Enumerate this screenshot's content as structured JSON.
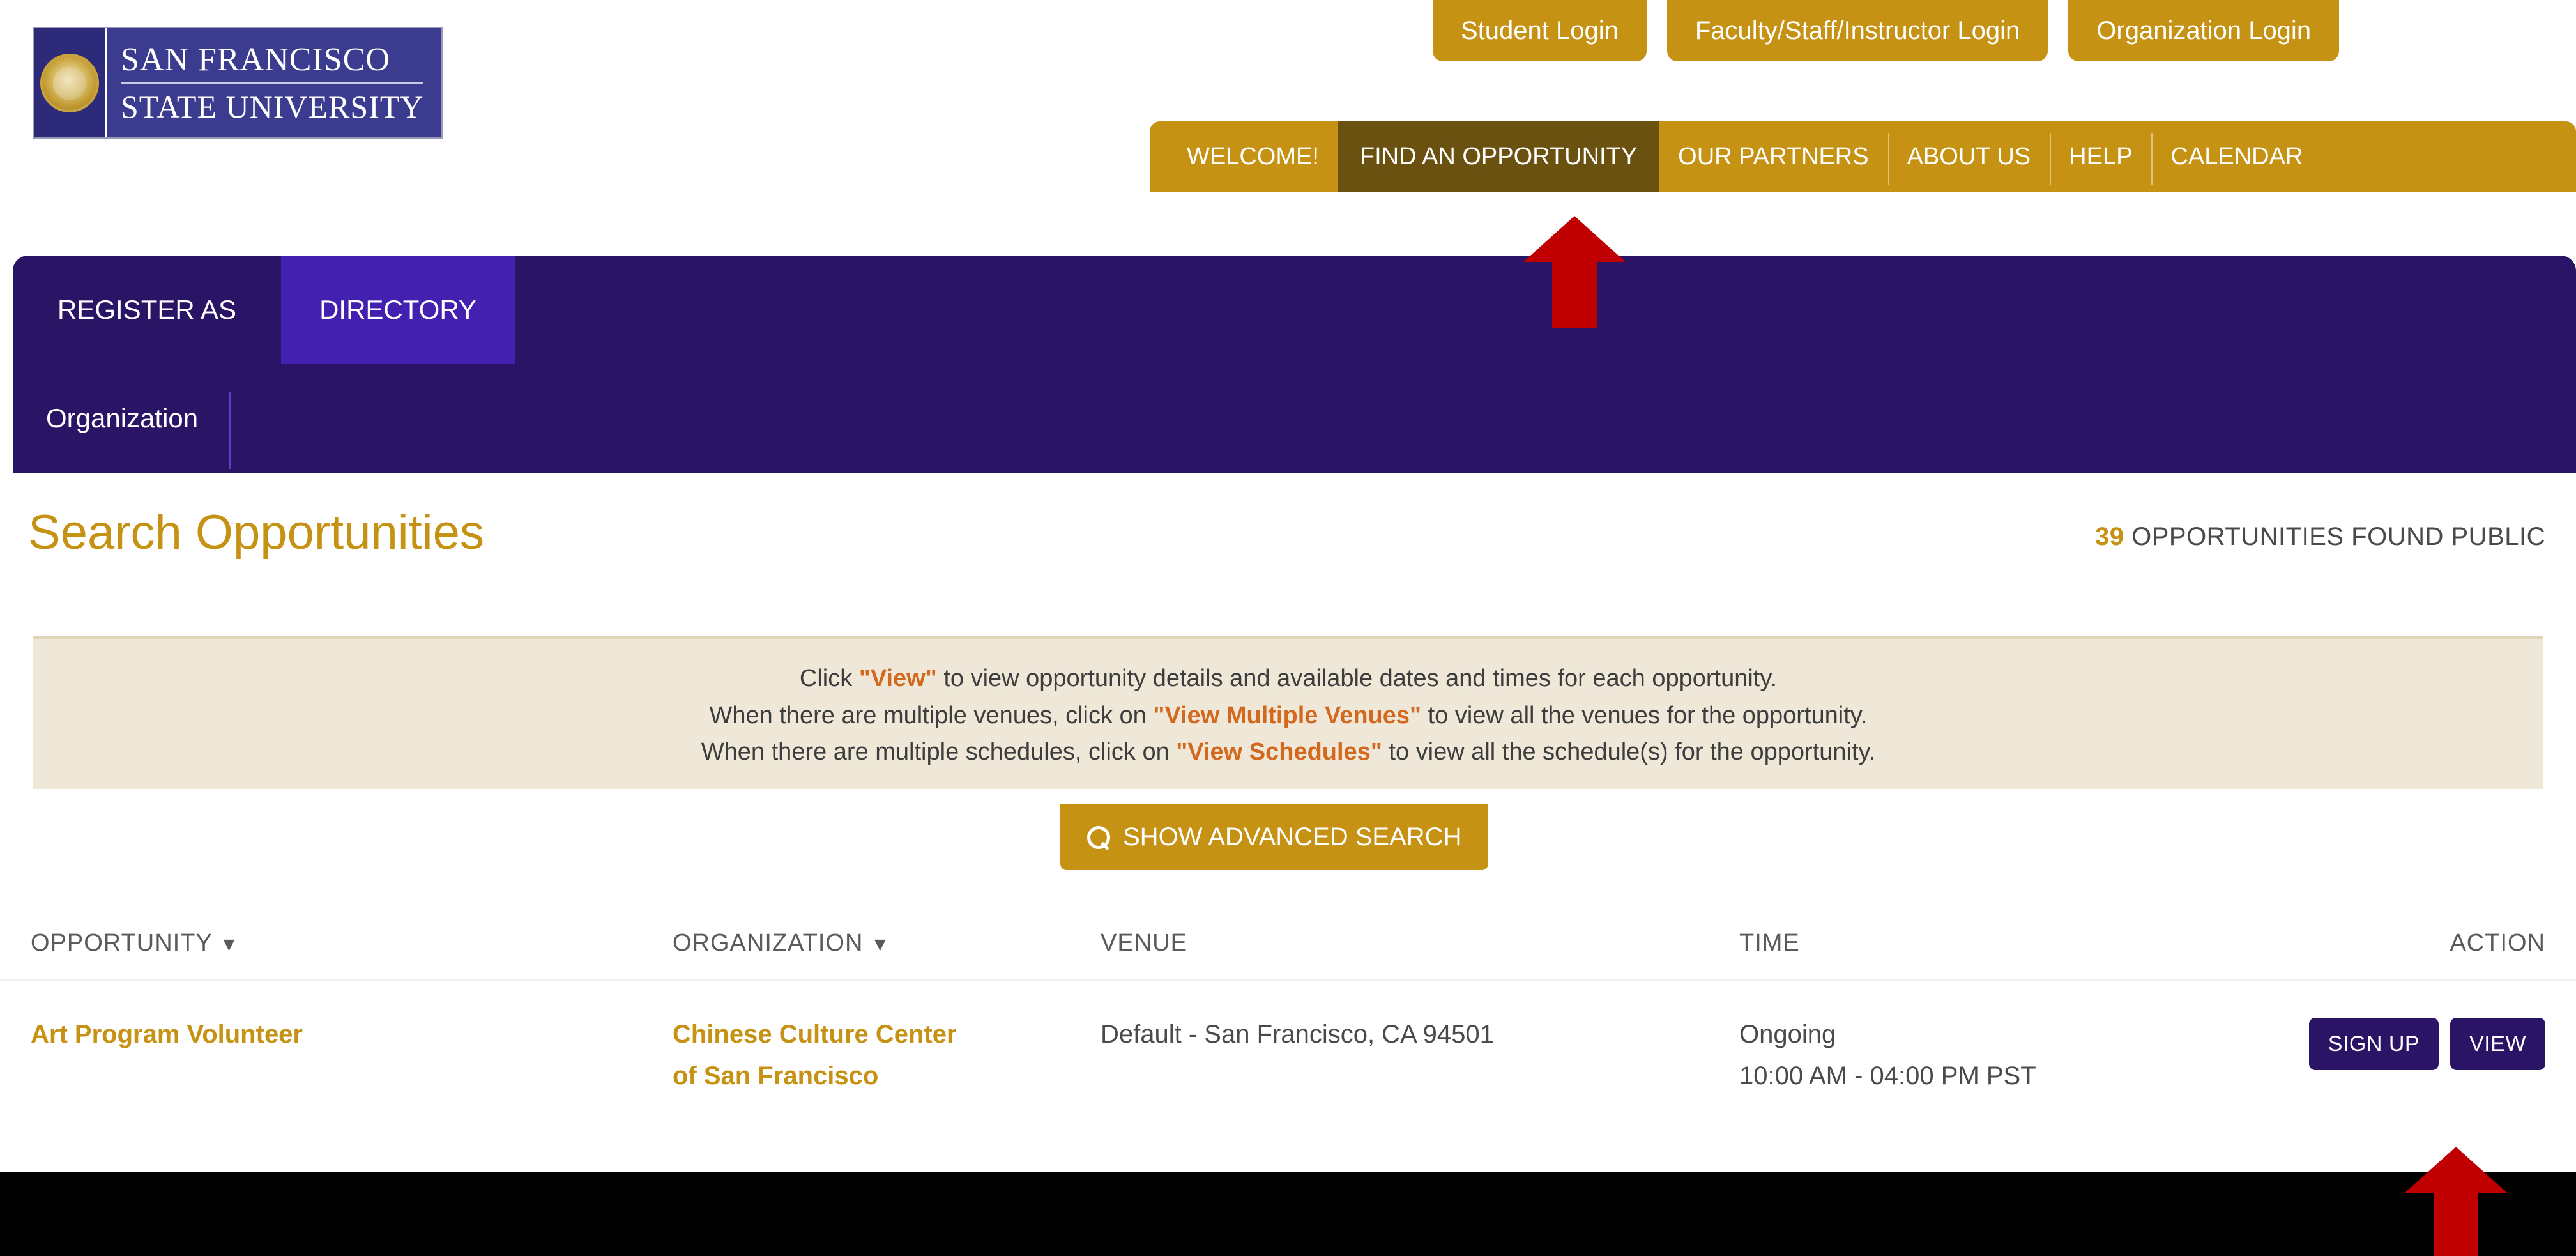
{
  "logo": {
    "line1": "SAN FRANCISCO",
    "line2": "STATE UNIVERSITY",
    "seal_alt": "sfsu-seal"
  },
  "login_buttons": [
    {
      "label": "Student Login"
    },
    {
      "label": "Faculty/Staff/Instructor Login"
    },
    {
      "label": "Organization Login"
    }
  ],
  "main_nav": [
    {
      "label": "WELCOME!",
      "active": false
    },
    {
      "label": "FIND AN OPPORTUNITY",
      "active": true
    },
    {
      "label": "OUR PARTNERS",
      "active": false
    },
    {
      "label": "ABOUT US",
      "active": false
    },
    {
      "label": "HELP",
      "active": false
    },
    {
      "label": "CALENDAR",
      "active": false
    }
  ],
  "tabs": {
    "primary": [
      {
        "label": "REGISTER AS",
        "active": false
      },
      {
        "label": "DIRECTORY",
        "active": true
      }
    ],
    "secondary": [
      {
        "label": "Organization",
        "active": true
      }
    ]
  },
  "page": {
    "title": "Search Opportunities",
    "result_count": "39",
    "result_suffix": "OPPORTUNITIES FOUND PUBLIC"
  },
  "info_box": {
    "line1_a": "Click ",
    "line1_hi": "\"View\"",
    "line1_b": " to view opportunity details and available dates and times for each opportunity.",
    "line2_a": "When there are multiple venues, click on ",
    "line2_hi": "\"View Multiple Venues\"",
    "line2_b": " to view all the venues for the opportunity.",
    "line3_a": "When there are multiple schedules, click on ",
    "line3_hi": "\"View Schedules\"",
    "line3_b": " to view all the schedule(s) for the opportunity."
  },
  "advanced_search": {
    "label": "SHOW ADVANCED SEARCH",
    "icon": "search-icon"
  },
  "table": {
    "headers": {
      "opportunity": "OPPORTUNITY",
      "opportunity_caret": "▼",
      "organization": "ORGANIZATION",
      "organization_caret": "▼",
      "venue": "VENUE",
      "time": "TIME",
      "action": "ACTION"
    },
    "rows": [
      {
        "opportunity": "Art Program Volunteer",
        "organization_line1": "Chinese Culture Center",
        "organization_line2": "of San Francisco",
        "venue": "Default - San Francisco, CA 94501",
        "time_line1": "Ongoing",
        "time_line2": "10:00 AM - 04:00 PM PST",
        "signup_label": "SIGN UP",
        "view_label": "VIEW"
      }
    ]
  },
  "colors": {
    "gold": "#C69214",
    "purple": "#2A1466",
    "purple_bright": "#4420B0",
    "nav_active": "#6B5110",
    "info_bg": "#EFE8D8",
    "highlight_orange": "#D2691E",
    "annotation_red": "#C00000"
  }
}
